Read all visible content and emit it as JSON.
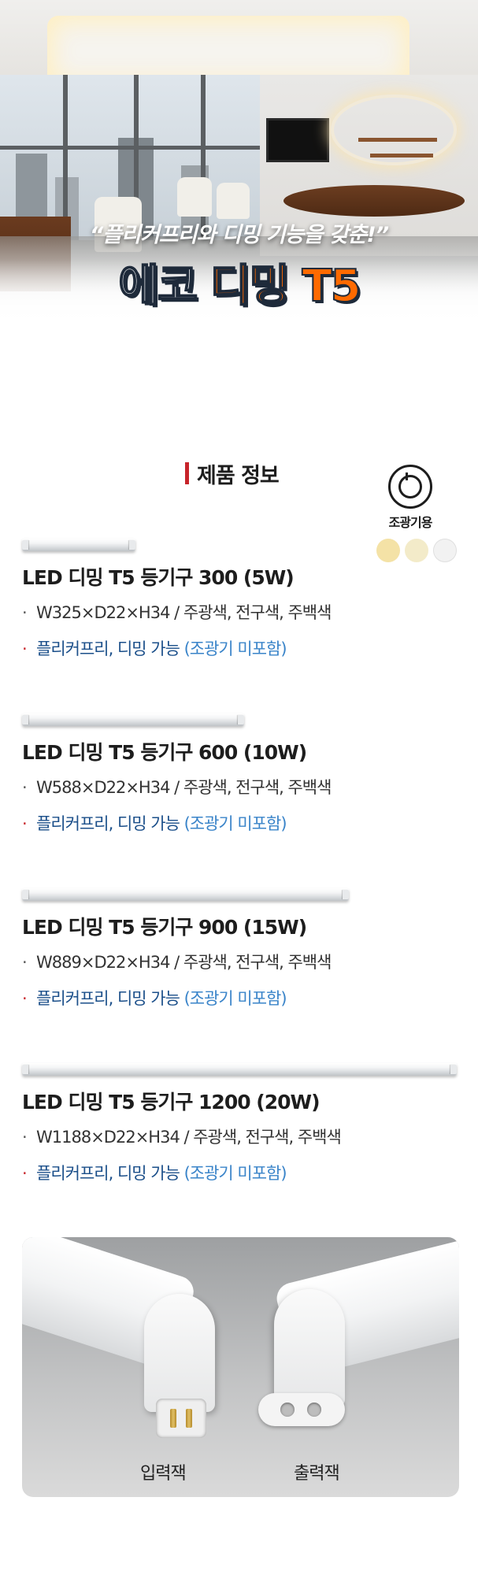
{
  "hero": {
    "tagline": "“플리커프리와 디밍 기능을 갖춘!”",
    "title_part1": "에코 ",
    "title_part2": "디밍 T5",
    "title_colors": {
      "part1": "#ffffff",
      "part2": "#ff6a00",
      "outline": "#1e2a3a"
    }
  },
  "section": {
    "heading": "제품 정보",
    "accent_color": "#c7242a"
  },
  "dimmer_badge": {
    "icon": "dimmer-knob-icon",
    "label": "조광기용",
    "swatches": [
      "#f4e2a6",
      "#f3ebc9",
      "#f2f2f2"
    ]
  },
  "products": [
    {
      "name": "LED 디밍 T5 등기구 300 (5W)",
      "bullet": "·",
      "spec": "W325×D22×H34  /  주광색, 전구색, 주백색",
      "feature": "플리커프리, 디밍 가능 ",
      "feature_note": "(조광기 미포함)"
    },
    {
      "name": "LED 디밍 T5 등기구 600 (10W)",
      "bullet": "·",
      "spec": "W588×D22×H34  /  주광색, 전구색, 주백색",
      "feature": "플리커프리, 디밍 가능 ",
      "feature_note": "(조광기 미포함)"
    },
    {
      "name": "LED 디밍 T5 등기구 900 (15W)",
      "bullet": "·",
      "spec": "W889×D22×H34  /  주광색, 전구색, 주백색",
      "feature": "플리커프리, 디밍 가능 ",
      "feature_note": "(조광기 미포함)"
    },
    {
      "name": "LED 디밍 T5 등기구 1200 (20W)",
      "bullet": "·",
      "spec": "W1188×D22×H34  /  주광색, 전구색, 주백색",
      "feature": "플리커프리, 디밍 가능 ",
      "feature_note": "(조광기 미포함)"
    }
  ],
  "connector_photo": {
    "input_label": "입력잭",
    "output_label": "출력잭"
  }
}
